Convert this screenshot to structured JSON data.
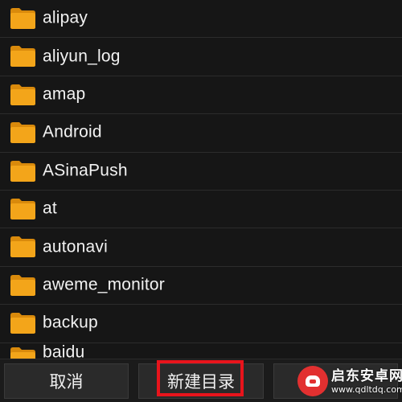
{
  "file_list": {
    "items": [
      {
        "name": "alipay",
        "icon": "folder-icon"
      },
      {
        "name": "aliyun_log",
        "icon": "folder-icon"
      },
      {
        "name": "amap",
        "icon": "folder-icon"
      },
      {
        "name": "Android",
        "icon": "folder-icon"
      },
      {
        "name": "ASinaPush",
        "icon": "folder-icon"
      },
      {
        "name": "at",
        "icon": "folder-icon"
      },
      {
        "name": "autonavi",
        "icon": "folder-icon"
      },
      {
        "name": "aweme_monitor",
        "icon": "folder-icon"
      },
      {
        "name": "backup",
        "icon": "folder-icon"
      },
      {
        "name": "baidu",
        "icon": "folder-icon"
      }
    ]
  },
  "bottom_bar": {
    "cancel_label": "取消",
    "new_folder_label": "新建目录",
    "third_label": ""
  },
  "watermark": {
    "title": "启东安卓网",
    "url": "www.qdltdq.com"
  },
  "colors": {
    "background": "#161616",
    "folder": "#f3a51a",
    "highlight": "#e8141c",
    "text": "#f2f2f2"
  }
}
